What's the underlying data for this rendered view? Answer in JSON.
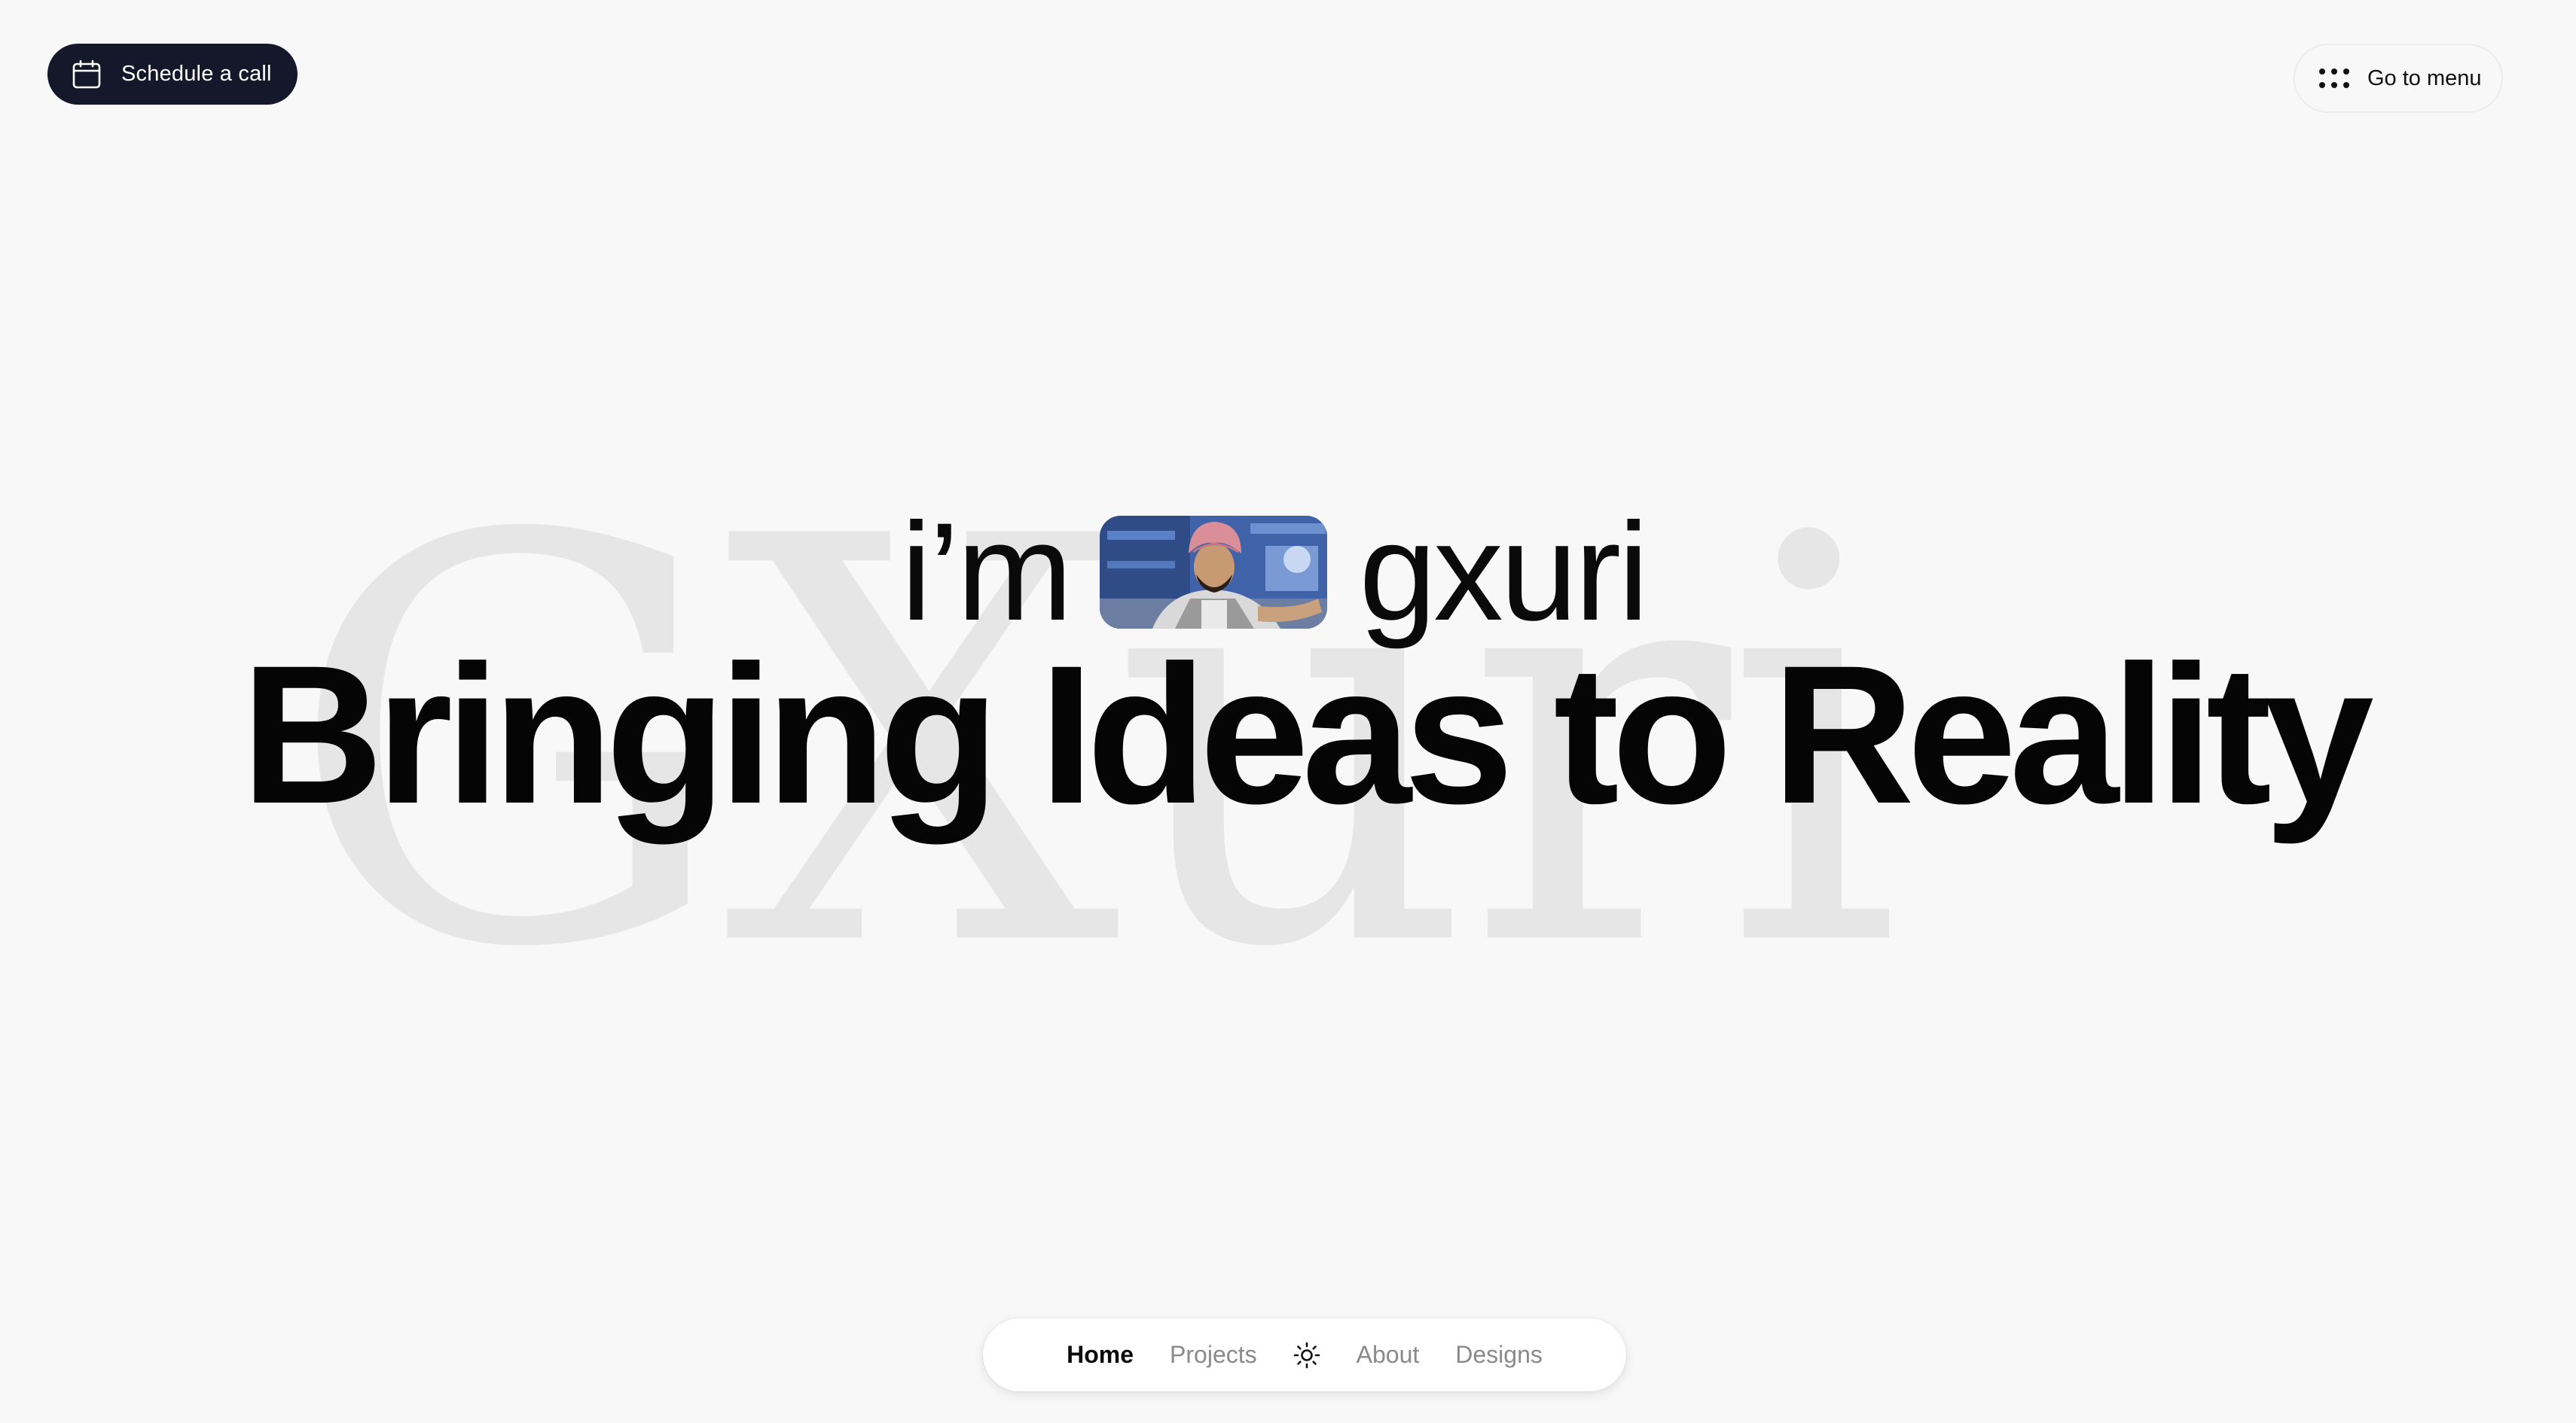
{
  "header": {
    "cta_label": "Schedule a call",
    "cta_icon": "calendar-icon",
    "menu_label": "Go to menu",
    "menu_icon": "dots-grid-icon"
  },
  "hero": {
    "intro_prefix": "i’m",
    "intro_name": "gxuri",
    "headline": "Bringing Ideas to Reality",
    "watermark": "GXuri"
  },
  "bottom_nav": {
    "items": [
      {
        "label": "Home",
        "active": true
      },
      {
        "label": "Projects",
        "active": false
      },
      {
        "label": "About",
        "active": false
      },
      {
        "label": "Designs",
        "active": false
      }
    ],
    "theme_toggle_icon": "sun-icon"
  },
  "colors": {
    "background": "#f8f8f8",
    "cta_background": "#14182a",
    "text": "#0a0a0a",
    "muted": "#8a8a8a",
    "watermark": "#e6e6e6"
  }
}
